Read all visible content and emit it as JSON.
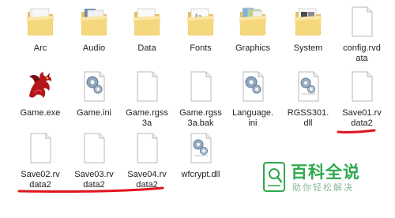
{
  "files": [
    {
      "name": "Arc",
      "type": "folder"
    },
    {
      "name": "Audio",
      "type": "folder"
    },
    {
      "name": "Data",
      "type": "folder"
    },
    {
      "name": "Fonts",
      "type": "folder"
    },
    {
      "name": "Graphics",
      "type": "folder"
    },
    {
      "name": "System",
      "type": "folder"
    },
    {
      "name": "config.rvd\nata",
      "type": "document"
    },
    {
      "name": "Game.exe",
      "type": "dragon-exe"
    },
    {
      "name": "Game.ini",
      "type": "settings"
    },
    {
      "name": "Game.rgss\n3a",
      "type": "document"
    },
    {
      "name": "Game.rgss\n3a.bak",
      "type": "document"
    },
    {
      "name": "Language.\nini",
      "type": "settings"
    },
    {
      "name": "RGSS301.\ndll",
      "type": "dll"
    },
    {
      "name": "Save01.rv\ndata2",
      "type": "document"
    },
    {
      "name": "Save02.rv\ndata2",
      "type": "document"
    },
    {
      "name": "Save03.rv\ndata2",
      "type": "document"
    },
    {
      "name": "Save04.rv\ndata2",
      "type": "document"
    },
    {
      "name": "wfcrypt.dll",
      "type": "dll"
    }
  ],
  "watermark": {
    "title": "百科全说",
    "subtitle": "助你轻松解决",
    "color": "#2fa84f"
  },
  "annotation_color": "#e0141e"
}
